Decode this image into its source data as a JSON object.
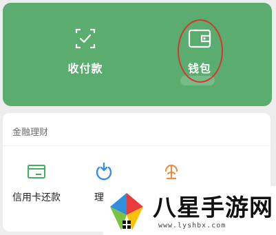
{
  "top": {
    "pay_label": "收付款",
    "wallet_label": "钱包"
  },
  "finance": {
    "title": "金融理财",
    "items": [
      {
        "label": "信用卡还款",
        "icon": "credit-card-icon"
      },
      {
        "label": "理财",
        "icon": "licai-icon"
      },
      {
        "label": "",
        "icon": "insurance-icon"
      }
    ]
  },
  "watermark": {
    "title": "八星手游网",
    "url": "www.lyshbx.com"
  },
  "colors": {
    "panel_green": "#5aac6f",
    "highlight_red": "#d7352f",
    "credit_green": "#3fae61",
    "licai_blue": "#3b8de0",
    "insurance_orange": "#e98f42"
  }
}
